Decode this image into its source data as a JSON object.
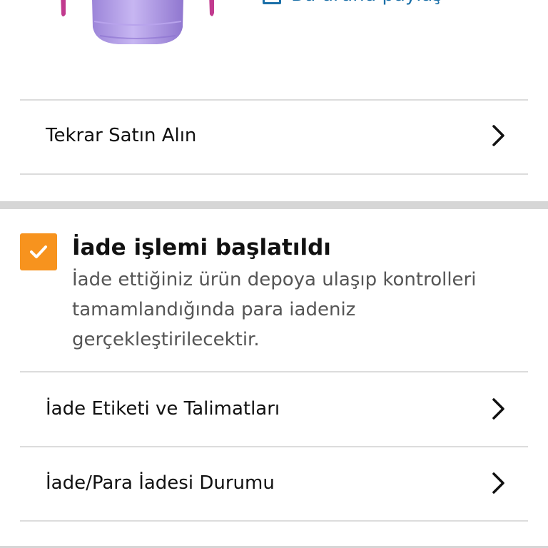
{
  "share": {
    "label": "Bu ürünü paylaş",
    "icon": "share-icon"
  },
  "rows": {
    "buy_again": {
      "label": "Tekrar Satın Alın",
      "icon": "chevron-right-icon"
    },
    "return_label": {
      "label": "İade Etiketi ve Talimatları",
      "icon": "chevron-right-icon"
    },
    "refund_status": {
      "label": "İade/Para İadesi Durumu",
      "icon": "chevron-right-icon"
    }
  },
  "status": {
    "title": "İade işlemi başlatıldı",
    "description": "İade ettiğiniz ürün depoya ulaşıp kontrolleri tamamlandığında para iadeniz gerçekleştirilecektir.",
    "icon": "checkbox-checked-icon",
    "accent_color": "#f7931e"
  },
  "colors": {
    "link": "#1a6fa8",
    "divider": "#dcdcdc",
    "section_band": "#d6d6d6",
    "product": "#a68fe0"
  }
}
